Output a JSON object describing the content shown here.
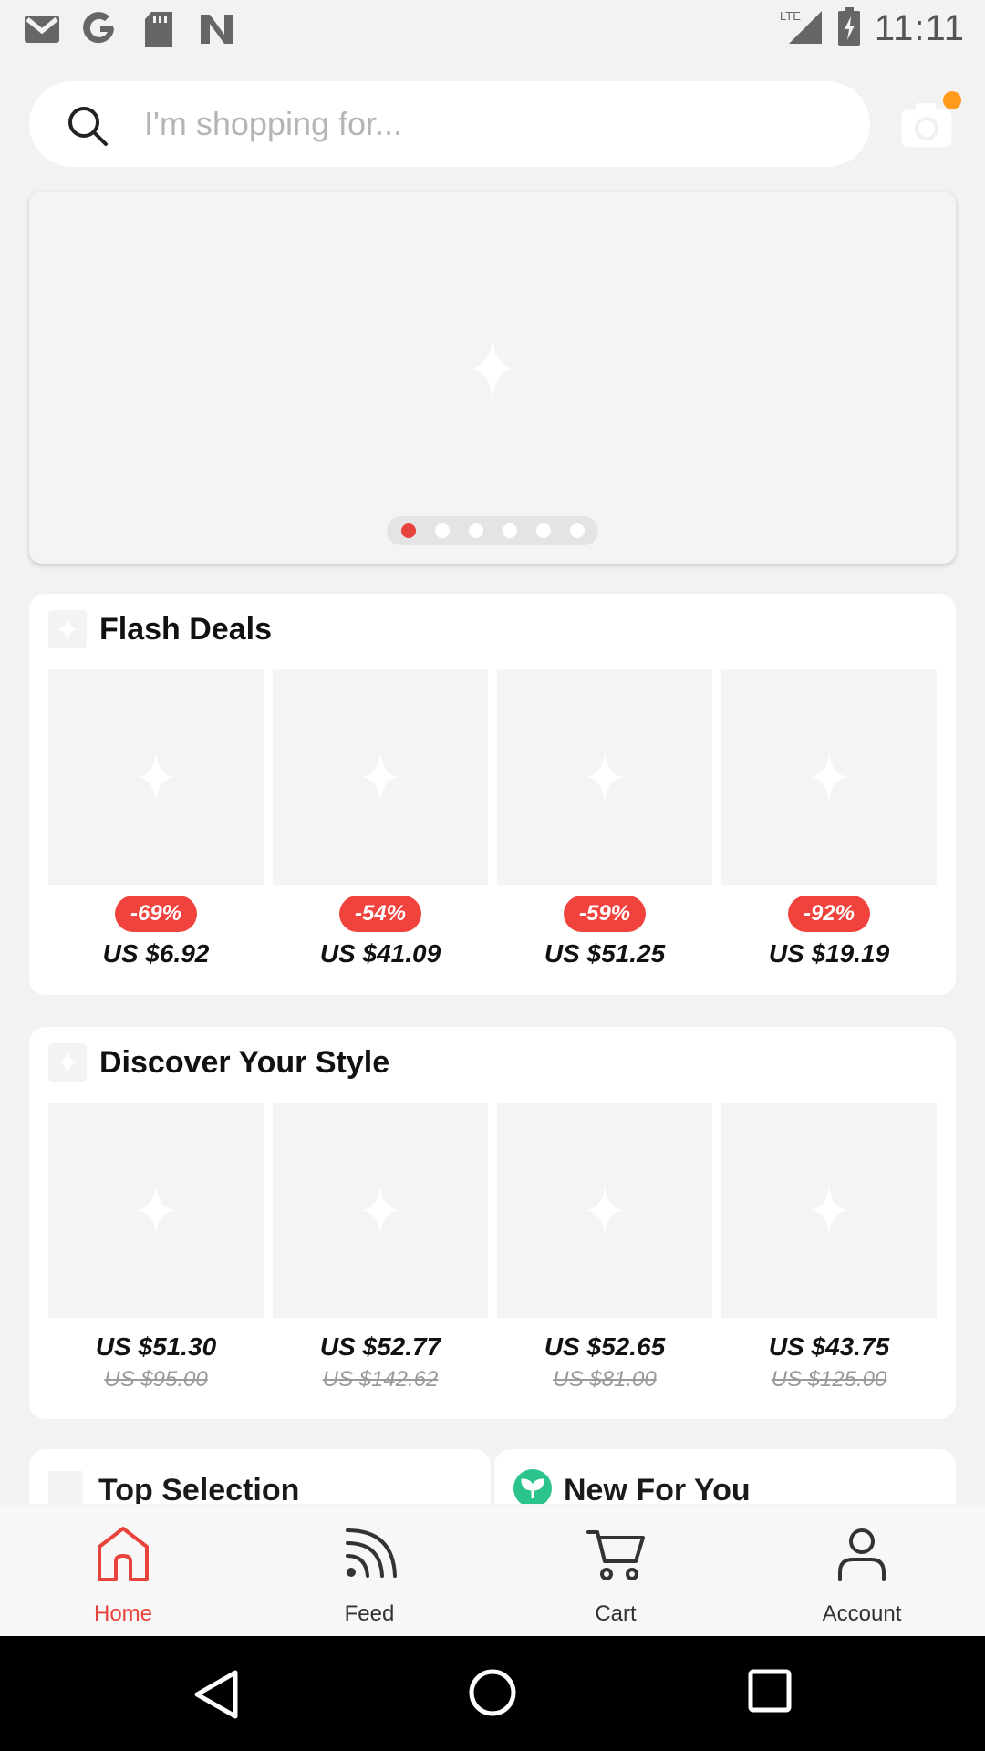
{
  "status_bar": {
    "time": "11:11",
    "network": "LTE",
    "left_icons": [
      "gmail-icon",
      "google-icon",
      "sd-card-icon",
      "n-app-icon"
    ]
  },
  "search": {
    "placeholder": "I'm shopping for..."
  },
  "banner": {
    "page_count": 6,
    "active_page": 1
  },
  "flash_deals": {
    "title": "Flash Deals",
    "items": [
      {
        "discount": "-69%",
        "price": "US $6.92"
      },
      {
        "discount": "-54%",
        "price": "US $41.09"
      },
      {
        "discount": "-59%",
        "price": "US $51.25"
      },
      {
        "discount": "-92%",
        "price": "US $19.19"
      }
    ]
  },
  "discover": {
    "title": "Discover Your Style",
    "items": [
      {
        "price": "US $51.30",
        "old_price": "US $95.00"
      },
      {
        "price": "US $52.77",
        "old_price": "US $142.62"
      },
      {
        "price": "US $52.65",
        "old_price": "US $81.00"
      },
      {
        "price": "US $43.75",
        "old_price": "US $125.00"
      }
    ]
  },
  "sections": {
    "top_selection": "Top Selection",
    "new_for_you": "New For You"
  },
  "bottom_nav": {
    "items": [
      {
        "label": "Home",
        "icon": "home-icon",
        "active": true
      },
      {
        "label": "Feed",
        "icon": "feed-icon",
        "active": false
      },
      {
        "label": "Cart",
        "icon": "cart-icon",
        "active": false
      },
      {
        "label": "Account",
        "icon": "account-icon",
        "active": false
      }
    ]
  },
  "colors": {
    "accent": "#e8423c",
    "notification": "#ff9a1b",
    "new_for_you_icon": "#2bc48a"
  }
}
